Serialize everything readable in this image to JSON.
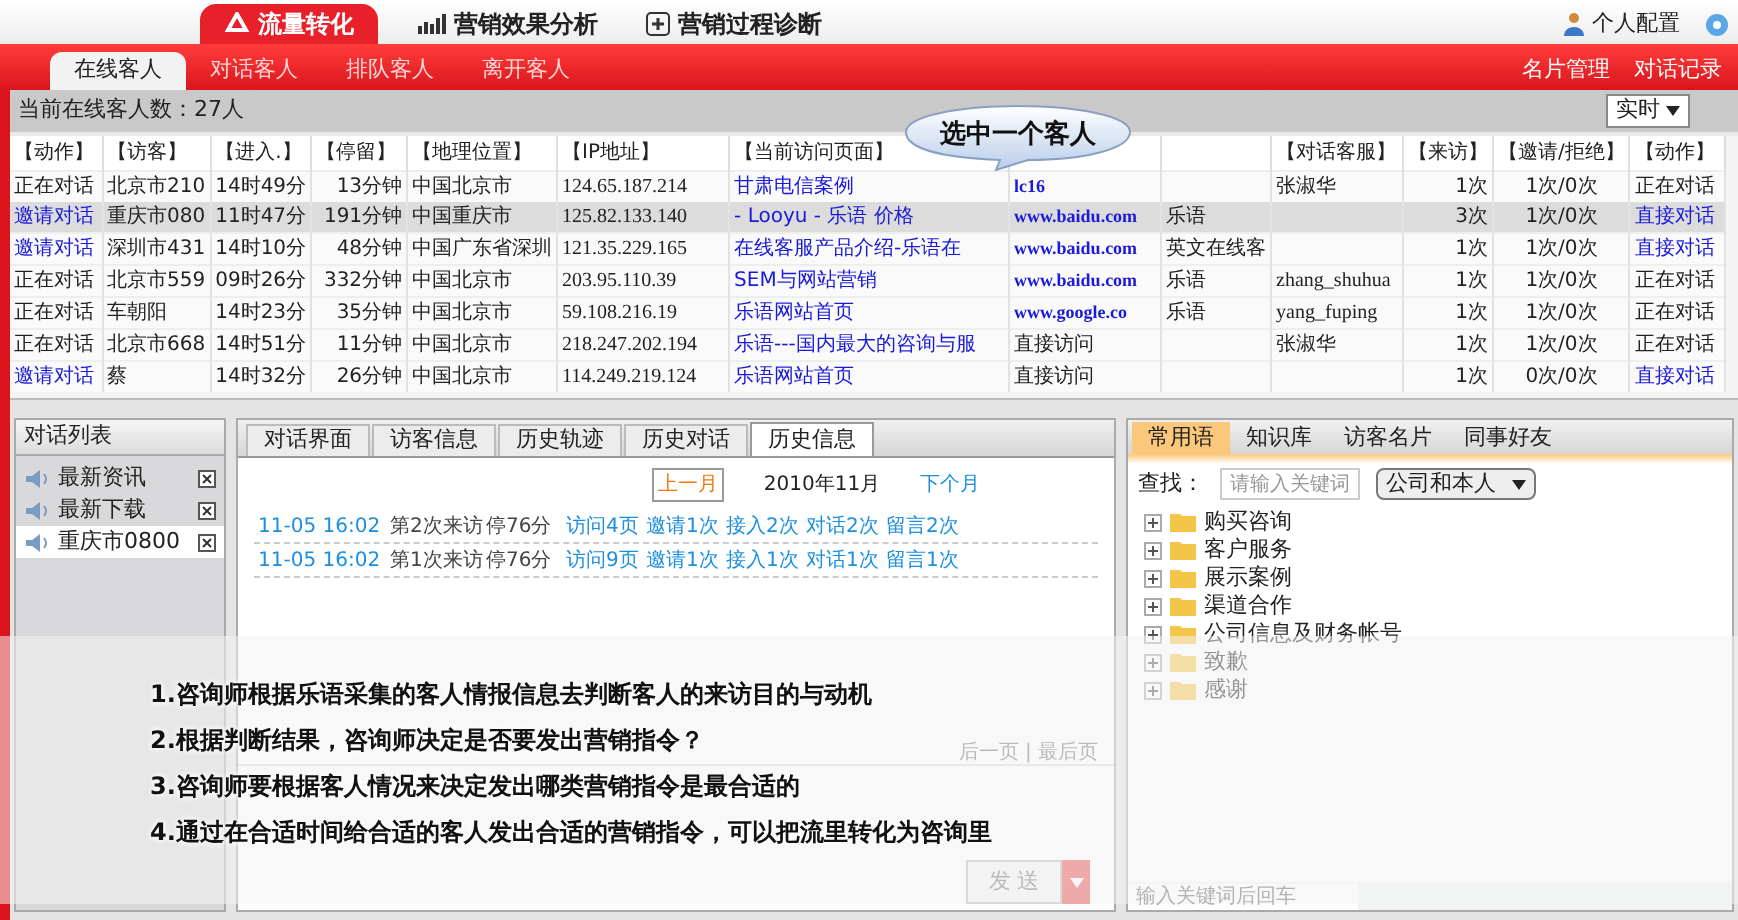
{
  "top_tabs": [
    {
      "label": "流量转化",
      "selected": true
    },
    {
      "label": "营销效果分析",
      "selected": false
    },
    {
      "label": "营销过程诊断",
      "selected": false
    }
  ],
  "user_menu": {
    "label": "个人配置"
  },
  "sub_tabs": [
    {
      "label": "在线客人",
      "selected": true
    },
    {
      "label": "对话客人",
      "selected": false
    },
    {
      "label": "排队客人",
      "selected": false
    },
    {
      "label": "离开客人",
      "selected": false
    }
  ],
  "sub_links": [
    "名片管理",
    "对话记录"
  ],
  "status": {
    "text": "当前在线客人数：27人",
    "mode": "实时"
  },
  "callout": "选中一个客人",
  "table": {
    "columns": [
      "【动作】",
      "【访客】",
      "【进入.】",
      "【停留】",
      "【地理位置】",
      "【IP地址】",
      "【当前访问页面】",
      "",
      "",
      "【对话客服】",
      "【来访】",
      "【邀请/拒绝】",
      "【动作】"
    ],
    "rows": [
      {
        "selected": false,
        "action": {
          "text": "正在对话",
          "link": false
        },
        "visitor": "北京市210",
        "enter": "14时49分",
        "stay": "13分钟",
        "location": "中国北京市",
        "ip": "124.65.187.214",
        "page": "甘肃电信案例",
        "source": {
          "text": "lc16",
          "link": true
        },
        "column_9": "",
        "agent": "张淑华",
        "visits": "1次",
        "invite": "1次/0次",
        "action2": {
          "text": "正在对话",
          "link": false
        }
      },
      {
        "selected": true,
        "action": {
          "text": "邀请对话",
          "link": true
        },
        "visitor": "重庆市080",
        "enter": "11时47分",
        "stay": "191分钟",
        "location": "中国重庆市",
        "ip": "125.82.133.140",
        "page": "- Looyu - 乐语 价格",
        "source": {
          "text": "www.baidu.com",
          "link": true
        },
        "column_9": "乐语",
        "agent": "",
        "visits": "3次",
        "invite": "1次/0次",
        "action2": {
          "text": "直接对话",
          "link": true
        }
      },
      {
        "selected": false,
        "action": {
          "text": "邀请对话",
          "link": true
        },
        "visitor": "深圳市431",
        "enter": "14时10分",
        "stay": "48分钟",
        "location": "中国广东省深圳",
        "ip": "121.35.229.165",
        "page": "在线客服产品介绍-乐语在",
        "source": {
          "text": "www.baidu.com",
          "link": true
        },
        "column_9": "英文在线客",
        "agent": "",
        "visits": "1次",
        "invite": "1次/0次",
        "action2": {
          "text": "直接对话",
          "link": true
        }
      },
      {
        "selected": false,
        "action": {
          "text": "正在对话",
          "link": false
        },
        "visitor": "北京市559",
        "enter": "09时26分",
        "stay": "332分钟",
        "location": "中国北京市",
        "ip": "203.95.110.39",
        "page": "SEM与网站营销",
        "source": {
          "text": "www.baidu.com",
          "link": true
        },
        "column_9": "乐语",
        "agent": "zhang_shuhua",
        "visits": "1次",
        "invite": "1次/0次",
        "action2": {
          "text": "正在对话",
          "link": false
        }
      },
      {
        "selected": false,
        "action": {
          "text": "正在对话",
          "link": false
        },
        "visitor": "车朝阳",
        "enter": "14时23分",
        "stay": "35分钟",
        "location": "中国北京市",
        "ip": "59.108.216.19",
        "page": "乐语网站首页",
        "source": {
          "text": "www.google.co",
          "link": true
        },
        "column_9": "乐语",
        "agent": "yang_fuping",
        "visits": "1次",
        "invite": "1次/0次",
        "action2": {
          "text": "正在对话",
          "link": false
        }
      },
      {
        "selected": false,
        "action": {
          "text": "正在对话",
          "link": false
        },
        "visitor": "北京市668",
        "enter": "14时51分",
        "stay": "11分钟",
        "location": "中国北京市",
        "ip": "218.247.202.194",
        "page": "乐语---国内最大的咨询与服",
        "source": {
          "text": "直接访问",
          "link": false
        },
        "column_9": "",
        "agent": "张淑华",
        "visits": "1次",
        "invite": "1次/0次",
        "action2": {
          "text": "正在对话",
          "link": false
        }
      },
      {
        "selected": false,
        "action": {
          "text": "邀请对话",
          "link": true
        },
        "visitor": "蔡",
        "enter": "14时32分",
        "stay": "26分钟",
        "location": "中国北京市",
        "ip": "114.249.219.124",
        "page": "乐语网站首页",
        "source": {
          "text": "直接访问",
          "link": false
        },
        "column_9": "",
        "agent": "",
        "visits": "1次",
        "invite": "0次/0次",
        "action2": {
          "text": "直接对话",
          "link": true
        }
      }
    ]
  },
  "chat_list": {
    "title": "对话列表",
    "items": [
      {
        "label": "最新资讯",
        "selected": false
      },
      {
        "label": "最新下载",
        "selected": false
      },
      {
        "label": "重庆市0800",
        "selected": true
      }
    ]
  },
  "center": {
    "tabs": [
      {
        "label": "对话界面",
        "selected": false
      },
      {
        "label": "访客信息",
        "selected": false
      },
      {
        "label": "历史轨迹",
        "selected": false
      },
      {
        "label": "历史对话",
        "selected": false
      },
      {
        "label": "历史信息",
        "selected": true
      }
    ],
    "prev_month": "上一月",
    "month": "2010年11月",
    "next_month": "下个月",
    "history": [
      {
        "time": "11-05 16:02",
        "visit": "第2次来访",
        "stay": "停76分",
        "links": [
          "访问4页",
          "邀请1次",
          "接入2次",
          "对话2次",
          "留言2次"
        ]
      },
      {
        "time": "11-05 16:02",
        "visit": "第1次来访",
        "stay": "停76分",
        "links": [
          "访问9页",
          "邀请1次",
          "接入1次",
          "对话1次",
          "留言1次"
        ]
      }
    ],
    "pager": "后一页 | 最后页",
    "send": "发 送"
  },
  "right": {
    "tabs": [
      {
        "label": "常用语",
        "selected": true
      },
      {
        "label": "知识库",
        "selected": false
      },
      {
        "label": "访客名片",
        "selected": false
      },
      {
        "label": "同事好友",
        "selected": false
      }
    ],
    "search_label": "查找：",
    "search_placeholder": "请输入关键词",
    "scope": "公司和本人",
    "folders": [
      "购买咨询",
      "客户服务",
      "展示案例",
      "渠道合作",
      "公司信息及财务帐号",
      "致歉",
      "感谢"
    ],
    "bottom_placeholder": "输入关键词后回车"
  },
  "overlay_lines": [
    "1.咨询师根据乐语采集的客人情报信息去判断客人的来访目的与动机",
    "2.根据判断结果，咨询师决定是否要发出营销指令？",
    "3.咨询师要根据客人情况来决定发出哪类营销指令是最合适的",
    "4.通过在合适时间给合适的客人发出合适的营销指令，可以把流里转化为咨询里"
  ]
}
